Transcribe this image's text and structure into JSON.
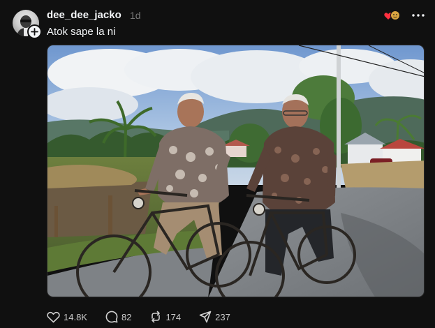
{
  "post": {
    "username": "dee_dee_jacko",
    "time_ago": "1d",
    "caption": "Atok sape la ni"
  },
  "photo": {
    "alt": "Two elderly men riding vintage bicycles on a rural road"
  },
  "actions": {
    "likes": "14.8K",
    "replies": "82",
    "reposts": "174",
    "shares": "237"
  },
  "colors": {
    "background": "#101010",
    "text": "#f3f5f7",
    "muted": "#777777",
    "heart_red": "#ff3040"
  },
  "icons": {
    "like": "heart-icon",
    "reply": "comment-icon",
    "repost": "repost-icon",
    "share": "send-icon",
    "more": "more-dots-icon",
    "follow": "plus-icon"
  }
}
